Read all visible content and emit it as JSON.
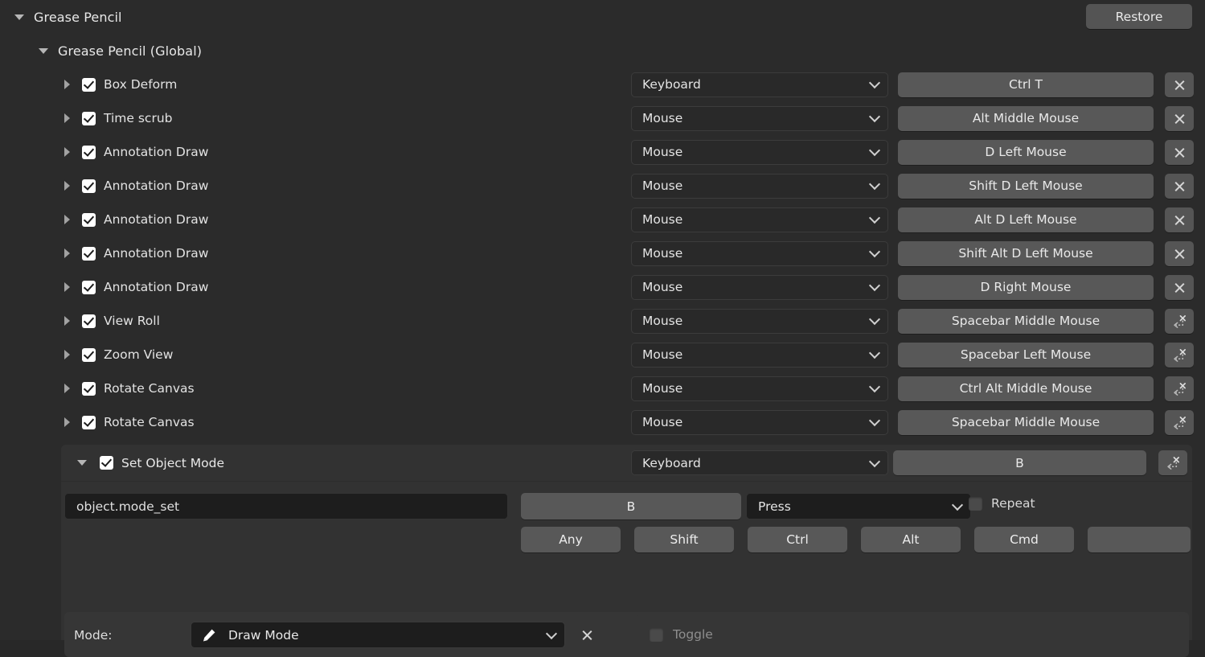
{
  "header": {
    "title": "Grease Pencil",
    "restore_label": "Restore",
    "expand_icon": "triangle-down-icon"
  },
  "subheader": {
    "title": "Grease Pencil (Global)",
    "expand_icon": "triangle-down-icon"
  },
  "keymap_rows": [
    {
      "label": "Box Deform",
      "type": "Keyboard",
      "key": "Ctrl T",
      "action_icon": "close-icon"
    },
    {
      "label": "Time scrub",
      "type": "Mouse",
      "key": "Alt Middle Mouse",
      "action_icon": "close-icon"
    },
    {
      "label": "Annotation Draw",
      "type": "Mouse",
      "key": "D Left Mouse",
      "action_icon": "close-icon"
    },
    {
      "label": "Annotation Draw",
      "type": "Mouse",
      "key": "Shift D Left Mouse",
      "action_icon": "close-icon"
    },
    {
      "label": "Annotation Draw",
      "type": "Mouse",
      "key": "Alt D Left Mouse",
      "action_icon": "close-icon"
    },
    {
      "label": "Annotation Draw",
      "type": "Mouse",
      "key": "Shift Alt D Left Mouse",
      "action_icon": "close-icon"
    },
    {
      "label": "Annotation Draw",
      "type": "Mouse",
      "key": "D Right Mouse",
      "action_icon": "close-icon"
    },
    {
      "label": "View Roll",
      "type": "Mouse",
      "key": "Spacebar Middle Mouse",
      "action_icon": "restore-icon"
    },
    {
      "label": "Zoom View",
      "type": "Mouse",
      "key": "Spacebar Left Mouse",
      "action_icon": "restore-icon"
    },
    {
      "label": "Rotate Canvas",
      "type": "Mouse",
      "key": "Ctrl Alt Middle Mouse",
      "action_icon": "restore-icon"
    },
    {
      "label": "Rotate Canvas",
      "type": "Mouse",
      "key": "Spacebar Middle Mouse",
      "action_icon": "restore-icon"
    }
  ],
  "expanded_item": {
    "label": "Set Object Mode",
    "type": "Keyboard",
    "key": "B",
    "action_icon": "restore-icon",
    "operator_id": "object.mode_set",
    "key_field": "B",
    "event_value": "Press",
    "repeat_label": "Repeat",
    "repeat_checked": false,
    "modifiers": [
      "Any",
      "Shift",
      "Ctrl",
      "Alt",
      "Cmd",
      ""
    ],
    "properties": {
      "mode_label": "Mode:",
      "mode_value": "Draw Mode",
      "mode_icon": "pencil-icon",
      "mode_clear_icon": "close-icon",
      "toggle_label": "Toggle",
      "toggle_checked": false
    }
  },
  "colors": {
    "background": "#2b2b2b",
    "panel": "#323232",
    "button": "#585858",
    "field": "#1d1d1d",
    "text": "#e3e3e3",
    "text_dim": "#8e8e8e"
  }
}
